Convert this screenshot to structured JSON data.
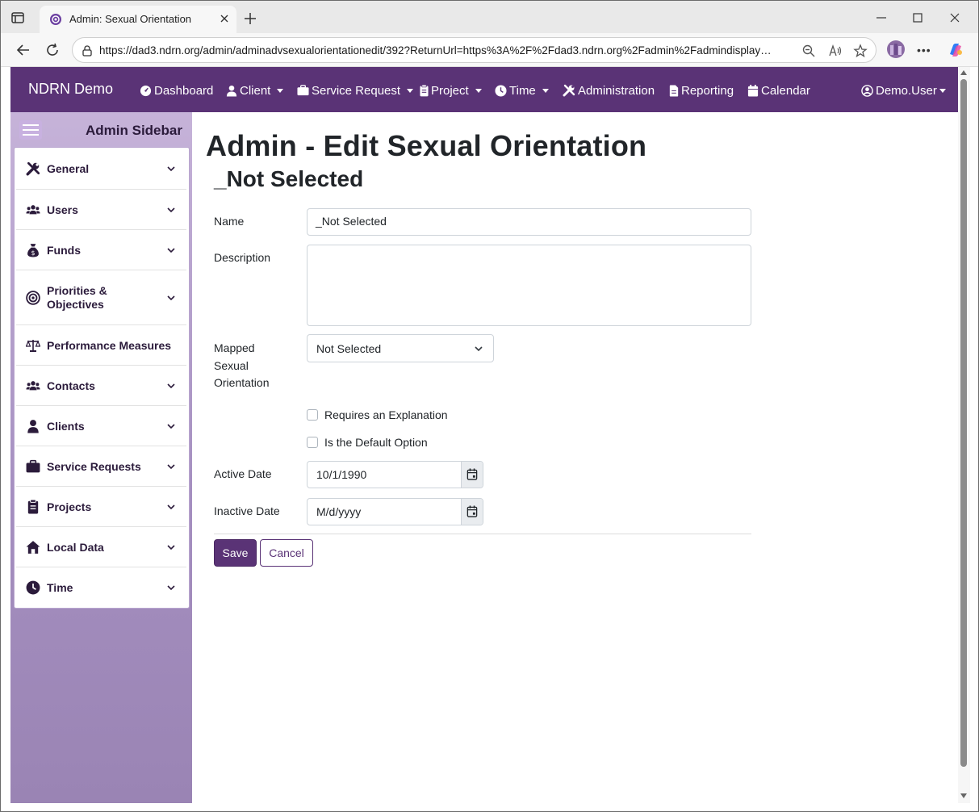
{
  "browser": {
    "tab_title": "Admin: Sexual Orientation",
    "url": "https://dad3.ndrn.org/admin/adminadvsexualorientationedit/392?ReturnUrl=https%3A%2F%2Fdad3.ndrn.org%2Fadmin%2Fadmindisplay…"
  },
  "navbar": {
    "brand": "NDRN Demo",
    "items": [
      {
        "label": "Dashboard",
        "icon": "dashboard-icon",
        "dropdown": false
      },
      {
        "label": "Client",
        "icon": "user-icon",
        "dropdown": true
      },
      {
        "label": "Service Request",
        "icon": "briefcase-icon",
        "dropdown": true
      },
      {
        "label": "Project",
        "icon": "clipboard-icon",
        "dropdown": true
      },
      {
        "label": "Time",
        "icon": "clock-icon",
        "dropdown": true
      },
      {
        "label": "Administration",
        "icon": "tools-icon",
        "dropdown": false
      },
      {
        "label": "Reporting",
        "icon": "file-icon",
        "dropdown": false
      },
      {
        "label": "Calendar",
        "icon": "calendar-icon",
        "dropdown": false
      }
    ],
    "user": "Demo.User"
  },
  "sidebar": {
    "title": "Admin Sidebar",
    "items": [
      {
        "label": "General",
        "icon": "tools-icon",
        "expandable": true
      },
      {
        "label": "Users",
        "icon": "users-icon",
        "expandable": true
      },
      {
        "label": "Funds",
        "icon": "money-bag-icon",
        "expandable": true
      },
      {
        "label": "Priorities & Objectives",
        "icon": "target-icon",
        "expandable": true
      },
      {
        "label": "Performance Measures",
        "icon": "scale-icon",
        "expandable": false
      },
      {
        "label": "Contacts",
        "icon": "users-icon",
        "expandable": true
      },
      {
        "label": "Clients",
        "icon": "user-icon",
        "expandable": true
      },
      {
        "label": "Service Requests",
        "icon": "briefcase-icon",
        "expandable": true
      },
      {
        "label": "Projects",
        "icon": "clipboard-icon",
        "expandable": true
      },
      {
        "label": "Local Data",
        "icon": "house-icon",
        "expandable": true
      },
      {
        "label": "Time",
        "icon": "clock-icon",
        "expandable": true
      }
    ]
  },
  "page": {
    "title": "Admin - Edit Sexual Orientation",
    "subtitle": "_Not Selected"
  },
  "form": {
    "name_label": "Name",
    "name_value": "_Not Selected",
    "description_label": "Description",
    "description_value": "",
    "mapped_label_1": "Mapped",
    "mapped_label_2": "Sexual",
    "mapped_label_3": "Orientation",
    "mapped_value": "Not Selected",
    "requires_explanation_label": "Requires an Explanation",
    "requires_explanation_checked": false,
    "default_option_label": "Is the Default Option",
    "default_option_checked": false,
    "active_date_label": "Active Date",
    "active_date_value": "10/1/1990",
    "inactive_date_label": "Inactive Date",
    "inactive_date_placeholder": "M/d/yyyy",
    "save_label": "Save",
    "cancel_label": "Cancel"
  },
  "colors": {
    "brand_purple": "#5a3376",
    "sidebar_top": "#c6b3d9",
    "sidebar_bottom": "#9a84b4"
  }
}
